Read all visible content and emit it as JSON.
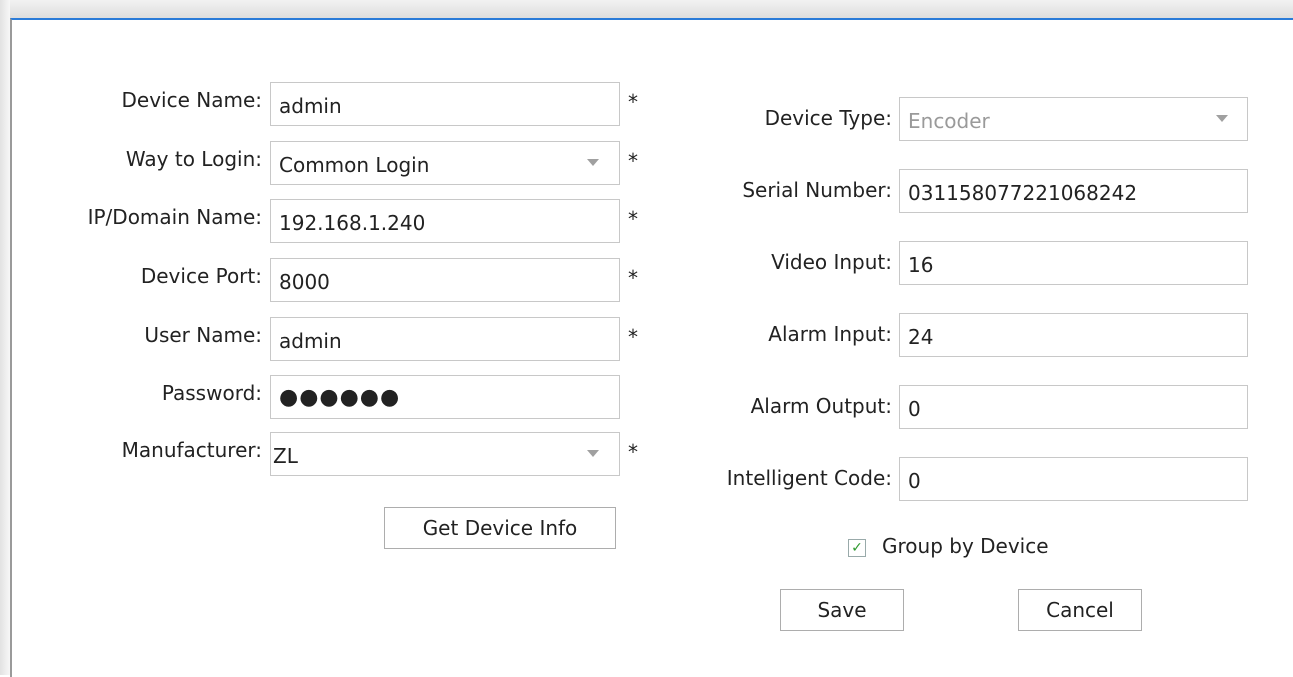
{
  "form_left": {
    "device_name": {
      "label": "Device Name:",
      "value": "admin",
      "required": "*"
    },
    "way_to_login": {
      "label": "Way to Login:",
      "value": "Common Login",
      "required": "*"
    },
    "ip_domain": {
      "label": "IP/Domain Name:",
      "value": "192.168.1.240",
      "required": "*"
    },
    "device_port": {
      "label": "Device Port:",
      "value": "8000",
      "required": "*"
    },
    "user_name": {
      "label": "User Name:",
      "value": "admin",
      "required": "*"
    },
    "password": {
      "label": "Password:",
      "value": "●●●●●●"
    },
    "manufacturer": {
      "label": "Manufacturer:",
      "value": "ZL",
      "required": "*"
    },
    "get_info_label": "Get Device Info"
  },
  "form_right": {
    "device_type": {
      "label": "Device Type:",
      "value": "Encoder"
    },
    "serial_number": {
      "label": "Serial Number:",
      "value": "031158077221068242"
    },
    "video_input": {
      "label": "Video Input:",
      "value": "16"
    },
    "alarm_input": {
      "label": "Alarm Input:",
      "value": "24"
    },
    "alarm_output": {
      "label": "Alarm Output:",
      "value": "0"
    },
    "intelligent_code": {
      "label": "Intelligent Code:",
      "value": "0"
    },
    "group_by_device": {
      "label": "Group by Device",
      "checked": true,
      "check_glyph": "✓"
    }
  },
  "actions": {
    "save_label": "Save",
    "cancel_label": "Cancel"
  }
}
